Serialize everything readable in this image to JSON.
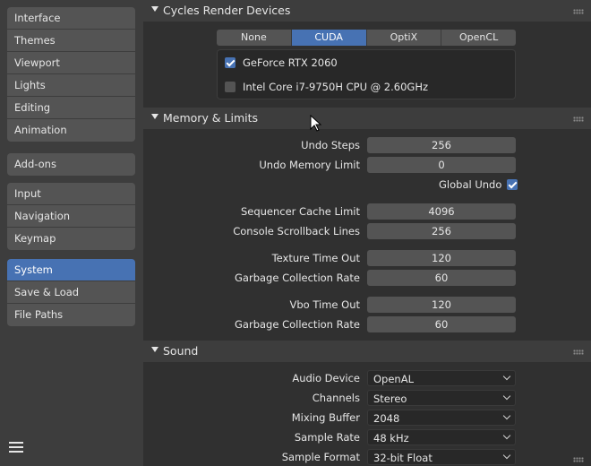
{
  "sidebar": {
    "groups": [
      [
        "Interface",
        "Themes",
        "Viewport",
        "Lights",
        "Editing",
        "Animation"
      ],
      [
        "Add-ons"
      ],
      [
        "Input",
        "Navigation",
        "Keymap"
      ],
      [
        "System",
        "Save & Load",
        "File Paths"
      ]
    ],
    "active": "System"
  },
  "cycles": {
    "title": "Cycles Render Devices",
    "tabs": [
      "None",
      "CUDA",
      "OptiX",
      "OpenCL"
    ],
    "selected_tab": "CUDA",
    "devices": [
      {
        "label": "GeForce RTX 2060",
        "checked": true
      },
      {
        "label": "Intel Core i7-9750H CPU @ 2.60GHz",
        "checked": false
      }
    ]
  },
  "memory": {
    "title": "Memory & Limits",
    "undo_steps": {
      "label": "Undo Steps",
      "value": "256"
    },
    "undo_memory": {
      "label": "Undo Memory Limit",
      "value": "0"
    },
    "global_undo": {
      "label": "Global Undo",
      "checked": true
    },
    "seq_cache": {
      "label": "Sequencer Cache Limit",
      "value": "4096"
    },
    "console_lines": {
      "label": "Console Scrollback Lines",
      "value": "256"
    },
    "texture_timeout": {
      "label": "Texture Time Out",
      "value": "120"
    },
    "texture_gc": {
      "label": "Garbage Collection Rate",
      "value": "60"
    },
    "vbo_timeout": {
      "label": "Vbo Time Out",
      "value": "120"
    },
    "vbo_gc": {
      "label": "Garbage Collection Rate",
      "value": "60"
    }
  },
  "sound": {
    "title": "Sound",
    "audio_device": {
      "label": "Audio Device",
      "value": "OpenAL"
    },
    "channels": {
      "label": "Channels",
      "value": "Stereo"
    },
    "mixing_buffer": {
      "label": "Mixing Buffer",
      "value": "2048"
    },
    "sample_rate": {
      "label": "Sample Rate",
      "value": "48 kHz"
    },
    "sample_format": {
      "label": "Sample Format",
      "value": "32-bit Float"
    }
  },
  "colors": {
    "accent": "#4772b3",
    "panel_bg": "#303030",
    "header_bg": "#3d3d3d",
    "field_bg": "#545454"
  },
  "icons": {
    "menu": "hamburger-icon",
    "collapse": "triangle-down-icon",
    "drag": "grip-icon",
    "pointer": "mouse-cursor-icon"
  }
}
